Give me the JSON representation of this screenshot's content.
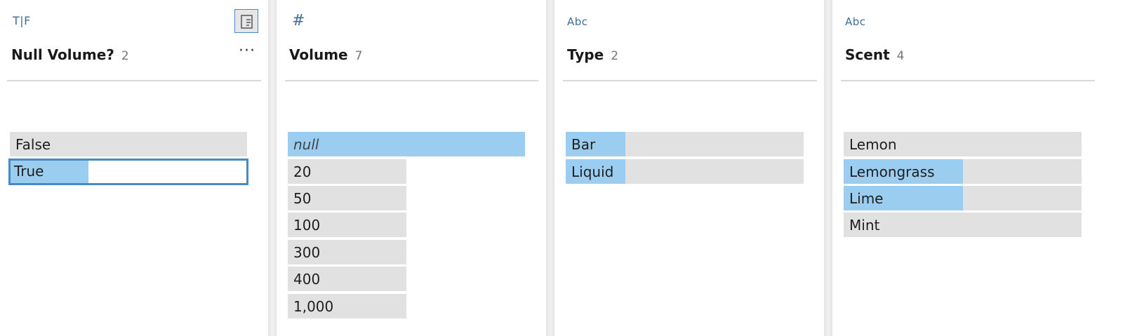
{
  "cards": [
    {
      "type_icon": "T|F",
      "type_icon_name": "boolean-type-icon",
      "title": "Null Volume?",
      "count": "2",
      "more_icon": "···",
      "details_icon": "view-details-icon",
      "values": [
        {
          "label": "False",
          "fraction": 0.0
        },
        {
          "label": "True",
          "fraction": 0.33,
          "selected": true
        }
      ]
    },
    {
      "type_icon": "#",
      "type_icon_name": "number-type-icon",
      "title": "Volume",
      "count": "7",
      "values": [
        {
          "label": "null",
          "fraction": 1.0,
          "italic": true
        },
        {
          "label": "20",
          "fraction": 0.0
        },
        {
          "label": "50",
          "fraction": 0.0
        },
        {
          "label": "100",
          "fraction": 0.0
        },
        {
          "label": "300",
          "fraction": 0.0
        },
        {
          "label": "400",
          "fraction": 0.0
        },
        {
          "label": "1,000",
          "fraction": 0.0
        }
      ]
    },
    {
      "type_icon": "Abc",
      "type_icon_name": "string-type-icon",
      "title": "Type",
      "count": "2",
      "values": [
        {
          "label": "Bar",
          "fraction": 0.25
        },
        {
          "label": "Liquid",
          "fraction": 0.25
        }
      ]
    },
    {
      "type_icon": "Abc",
      "type_icon_name": "string-type-icon",
      "title": "Scent",
      "count": "4",
      "values": [
        {
          "label": "Lemon",
          "fraction": 0.0
        },
        {
          "label": "Lemongrass",
          "fraction": 0.5
        },
        {
          "label": "Lime",
          "fraction": 0.5
        },
        {
          "label": "Mint",
          "fraction": 0.0
        }
      ]
    }
  ],
  "colors": {
    "bar_background": "#e1e1e1",
    "bar_fill": "#9acdef",
    "selection_border": "#4a8ac4",
    "type_icon": "#3c6f9a"
  }
}
